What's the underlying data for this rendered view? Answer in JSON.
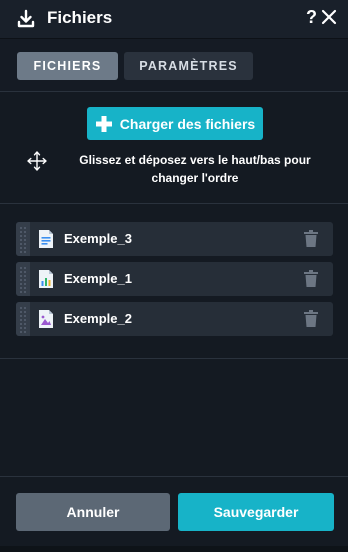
{
  "header": {
    "title": "Fichiers",
    "help_label": "?",
    "icon": "download-icon",
    "close_icon": "close-icon"
  },
  "tabs": [
    {
      "label": "FICHIERS",
      "active": true
    },
    {
      "label": "PARAMÈTRES",
      "active": false
    }
  ],
  "upload": {
    "label": "Charger des fichiers",
    "icon": "plus-icon"
  },
  "hint": {
    "icon": "move-arrows-icon",
    "text": "Glissez et déposez vers le haut/bas pour changer l'ordre"
  },
  "files": [
    {
      "name": "Exemple_3",
      "icon": "document-icon"
    },
    {
      "name": "Exemple_1",
      "icon": "spreadsheet-chart-icon"
    },
    {
      "name": "Exemple_2",
      "icon": "image-file-icon"
    }
  ],
  "footer": {
    "cancel_label": "Annuler",
    "save_label": "Sauvegarder"
  },
  "colors": {
    "accent": "#17b3c8",
    "background": "#141a22",
    "row": "#262e38"
  }
}
